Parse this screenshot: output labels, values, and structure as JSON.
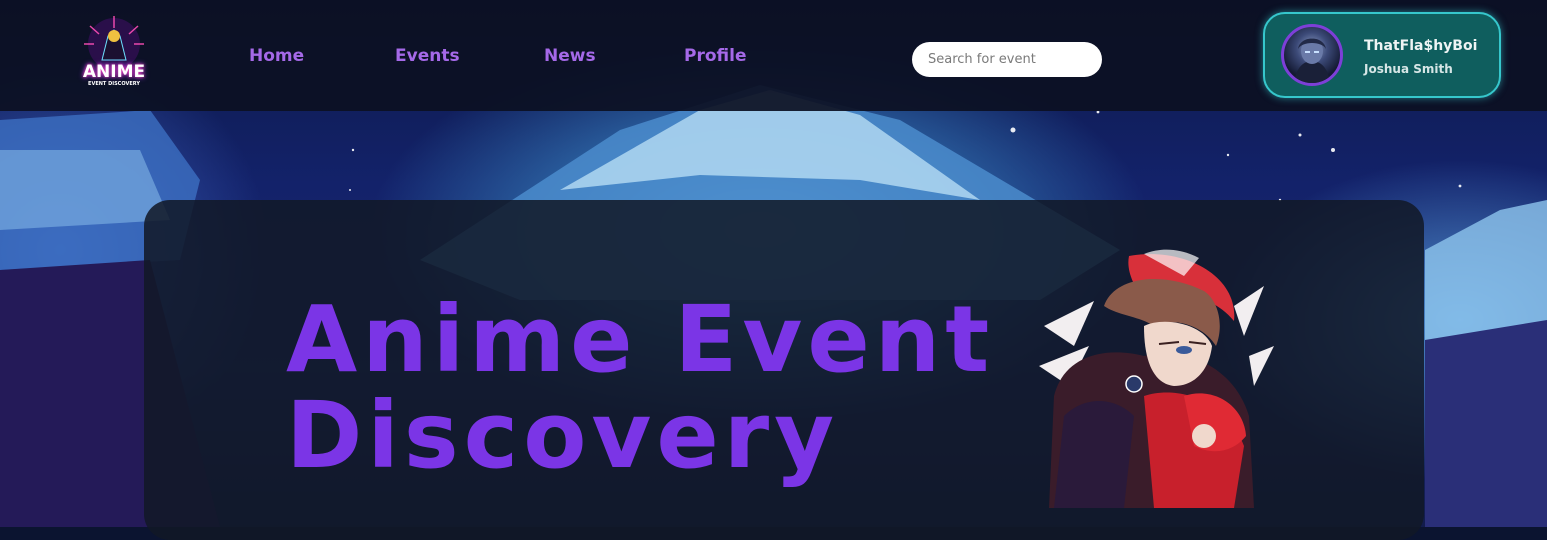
{
  "brand": {
    "logo_text": "ANIME",
    "logo_subtext": "EVENT DISCOVERY"
  },
  "nav": {
    "items": [
      {
        "label": "Home"
      },
      {
        "label": "Events"
      },
      {
        "label": "News"
      },
      {
        "label": "Profile"
      }
    ]
  },
  "search": {
    "placeholder": "Search for event",
    "value": ""
  },
  "user": {
    "username": "ThatFla$hyBoi",
    "full_name": "Joshua Smith"
  },
  "hero": {
    "title_line1": "Anime Event",
    "title_line2": "Discovery"
  },
  "colors": {
    "accent_purple": "#7b35e6",
    "nav_purple": "#a569e8",
    "user_card_bg": "#0f5e5e",
    "user_card_border": "#36c7cc",
    "header_bg": "#0c1022"
  }
}
